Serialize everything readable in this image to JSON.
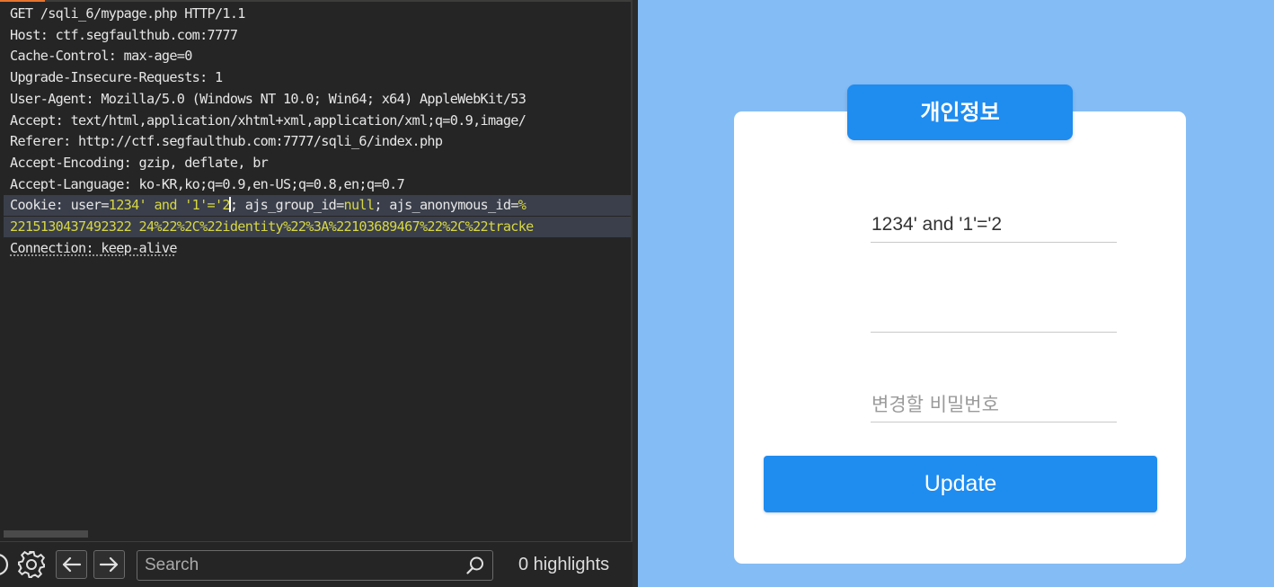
{
  "request_editor": {
    "lines": [
      [
        {
          "t": "GET /sqli_6/mypage.php HTTP/1.1",
          "c": "hval"
        }
      ],
      [
        {
          "t": "Host",
          "c": "hname"
        },
        {
          "t": ": ",
          "c": "colon"
        },
        {
          "t": "ctf.segfaulthub.com:7777",
          "c": "hval"
        }
      ],
      [
        {
          "t": "Cache-Control",
          "c": "hname"
        },
        {
          "t": ": ",
          "c": "colon"
        },
        {
          "t": "max-age=0",
          "c": "hval"
        }
      ],
      [
        {
          "t": "Upgrade-Insecure-Requests",
          "c": "hname"
        },
        {
          "t": ": ",
          "c": "colon"
        },
        {
          "t": "1",
          "c": "hval"
        }
      ],
      [
        {
          "t": "User-Agent",
          "c": "hname"
        },
        {
          "t": ": ",
          "c": "colon"
        },
        {
          "t": "Mozilla/5.0 (Windows NT 10.0; Win64; x64) AppleWebKit/53",
          "c": "hval"
        }
      ],
      [
        {
          "t": "Accept",
          "c": "hname"
        },
        {
          "t": ": ",
          "c": "colon"
        },
        {
          "t": "text/html,application/xhtml+xml,application/xml;q=0.9,image/",
          "c": "hval"
        }
      ],
      [
        {
          "t": "Referer",
          "c": "hname"
        },
        {
          "t": ": ",
          "c": "colon"
        },
        {
          "t": "http://ctf.segfaulthub.com:7777/sqli_6/index.php",
          "c": "hval"
        }
      ],
      [
        {
          "t": "Accept-Encoding",
          "c": "hname"
        },
        {
          "t": ": ",
          "c": "colon"
        },
        {
          "t": "gzip, deflate, br",
          "c": "hval"
        }
      ],
      [
        {
          "t": "Accept-Language",
          "c": "hname"
        },
        {
          "t": ": ",
          "c": "colon"
        },
        {
          "t": "ko-KR,ko;q=0.9,en-US;q=0.8,en;q=0.7",
          "c": "hval"
        }
      ],
      [
        {
          "t": "Cookie",
          "c": "hname"
        },
        {
          "t": ": ",
          "c": "colon"
        },
        {
          "t": "user=",
          "c": "ckey"
        },
        {
          "t": "1234' and '1'='2",
          "c": "cval"
        },
        {
          "t": "",
          "c": "caret"
        },
        {
          "t": "; ajs_group_id=",
          "c": "ckey"
        },
        {
          "t": "null",
          "c": "cval"
        },
        {
          "t": "; ajs_anonymous_id=",
          "c": "ckey"
        },
        {
          "t": "%",
          "c": "cval"
        }
      ],
      [
        {
          "t": "2215130437492322 24%22%2C%22identity%22%3A%22103689467%22%2C%22tracke",
          "c": "cval"
        }
      ],
      [
        {
          "t": "Connection",
          "c": "hname conn"
        },
        {
          "t": ": ",
          "c": "colon conn"
        },
        {
          "t": "keep-alive",
          "c": "hval conn"
        }
      ]
    ],
    "selected_lines": [
      9,
      10
    ]
  },
  "bottom_bar": {
    "search_placeholder": "Search",
    "highlights_label": "0 highlights"
  },
  "page": {
    "title": "개인정보",
    "user_field_value": "1234' and '1'='2",
    "email_field_value": "",
    "password_placeholder": "변경할 비밀번호",
    "update_label": "Update"
  }
}
